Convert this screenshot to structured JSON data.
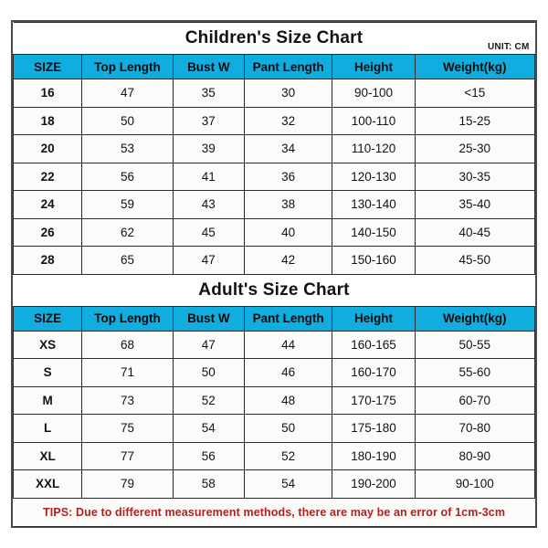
{
  "unit_label": "UNIT: CM",
  "columns": [
    "SIZE",
    "Top Length",
    "Bust W",
    "Pant Length",
    "Height",
    "Weight(kg)"
  ],
  "children": {
    "title": "Children's Size Chart",
    "rows": [
      [
        "16",
        "47",
        "35",
        "30",
        "90-100",
        "<15"
      ],
      [
        "18",
        "50",
        "37",
        "32",
        "100-110",
        "15-25"
      ],
      [
        "20",
        "53",
        "39",
        "34",
        "110-120",
        "25-30"
      ],
      [
        "22",
        "56",
        "41",
        "36",
        "120-130",
        "30-35"
      ],
      [
        "24",
        "59",
        "43",
        "38",
        "130-140",
        "35-40"
      ],
      [
        "26",
        "62",
        "45",
        "40",
        "140-150",
        "40-45"
      ],
      [
        "28",
        "65",
        "47",
        "42",
        "150-160",
        "45-50"
      ]
    ]
  },
  "adult": {
    "title": "Adult's Size Chart",
    "rows": [
      [
        "XS",
        "68",
        "47",
        "44",
        "160-165",
        "50-55"
      ],
      [
        "S",
        "71",
        "50",
        "46",
        "160-170",
        "55-60"
      ],
      [
        "M",
        "73",
        "52",
        "48",
        "170-175",
        "60-70"
      ],
      [
        "L",
        "75",
        "54",
        "50",
        "175-180",
        "70-80"
      ],
      [
        "XL",
        "77",
        "56",
        "52",
        "180-190",
        "80-90"
      ],
      [
        "XXL",
        "79",
        "58",
        "54",
        "190-200",
        "90-100"
      ]
    ]
  },
  "tips": "TIPS: Due to different measurement methods, there are may be an error of 1cm-3cm",
  "colors": {
    "header_blue": "#12addf",
    "tips_red": "#b32020",
    "cell_background": "#fbfbf9",
    "border": "#2b2b2b",
    "frame": "#4b4b4b"
  }
}
